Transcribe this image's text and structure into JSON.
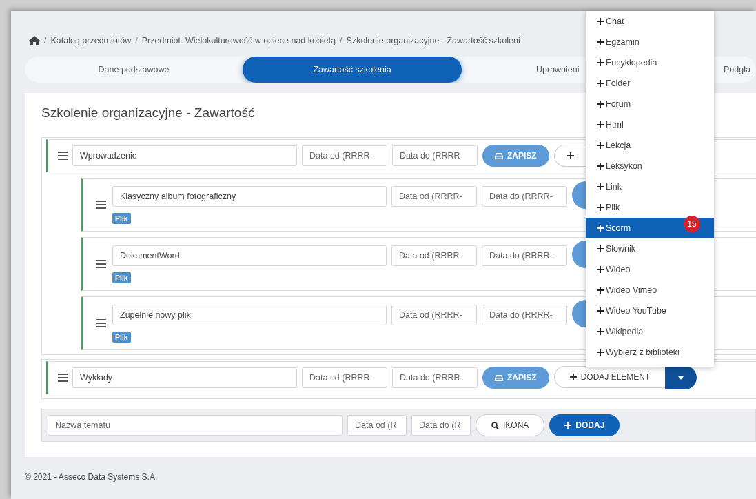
{
  "breadcrumb": [
    {
      "separator": "/",
      "label": "Katalog przedmiotów"
    },
    {
      "separator": "/",
      "label": "Przedmiot: Wielokulturowość w opiece nad kobietą"
    },
    {
      "separator": "/",
      "label": "Szkolenie organizacyjne - Zawartość szkoleni"
    }
  ],
  "tabs": [
    {
      "label": "Dane podstawowe",
      "selected": false
    },
    {
      "label": "Zawartość szkolenia",
      "selected": true
    },
    {
      "label": "Uprawnieni",
      "selected": false
    },
    {
      "label": "Podgla",
      "selected": false
    }
  ],
  "content": {
    "title": "Szkolenie organizacyjne - Zawartość",
    "topics": [
      {
        "name": "Wprowadzenie",
        "date_from_placeholder": "Data od (RRRR-",
        "date_to_placeholder": "Data do (RRRR-",
        "save_label": "ZAPISZ",
        "children": [
          {
            "name": "Klasyczny album fotograficzny",
            "date_from_placeholder": "Data od (RRRR-",
            "date_to_placeholder": "Data do (RRRR-",
            "tag": "Plik"
          },
          {
            "name": "DokumentWord",
            "date_from_placeholder": "Data od (RRRR-",
            "date_to_placeholder": "Data do (RRRR-",
            "tag": "Plik"
          },
          {
            "name": "Zupełnie nowy plik",
            "date_from_placeholder": "Data od (RRRR-",
            "date_to_placeholder": "Data do (RRRR-",
            "tag": "Plik"
          }
        ]
      },
      {
        "name": "Wykłady",
        "date_from_placeholder": "Data od (RRRR-",
        "date_to_placeholder": "Data do (RRRR-",
        "save_label": "ZAPISZ",
        "add_label": "DODAJ ELEMENT"
      }
    ]
  },
  "new_topic": {
    "name_placeholder": "Nazwa tematu",
    "date_from_placeholder": "Data od (R",
    "date_to_placeholder": "Data do (R",
    "icon_label": "IKONA",
    "add_label": "DODAJ"
  },
  "add_menu": {
    "badge": "15",
    "items": [
      {
        "label": "Chat",
        "selected": false
      },
      {
        "label": "Egzamin",
        "selected": false
      },
      {
        "label": "Encyklopedia",
        "selected": false
      },
      {
        "label": "Folder",
        "selected": false
      },
      {
        "label": "Forum",
        "selected": false
      },
      {
        "label": "Html",
        "selected": false
      },
      {
        "label": "Lekcja",
        "selected": false
      },
      {
        "label": "Leksykon",
        "selected": false
      },
      {
        "label": "Link",
        "selected": false
      },
      {
        "label": "Plik",
        "selected": false
      },
      {
        "label": "Scorm",
        "selected": true
      },
      {
        "label": "Słownik",
        "selected": false
      },
      {
        "label": "Wideo",
        "selected": false
      },
      {
        "label": "Wideo Vimeo",
        "selected": false
      },
      {
        "label": "Wideo YouTube",
        "selected": false
      },
      {
        "label": "Wikipedia",
        "selected": false
      },
      {
        "label": "Wybierz z biblioteki",
        "selected": false
      }
    ]
  },
  "footer": "© 2021 - Asseco Data Systems S.A."
}
